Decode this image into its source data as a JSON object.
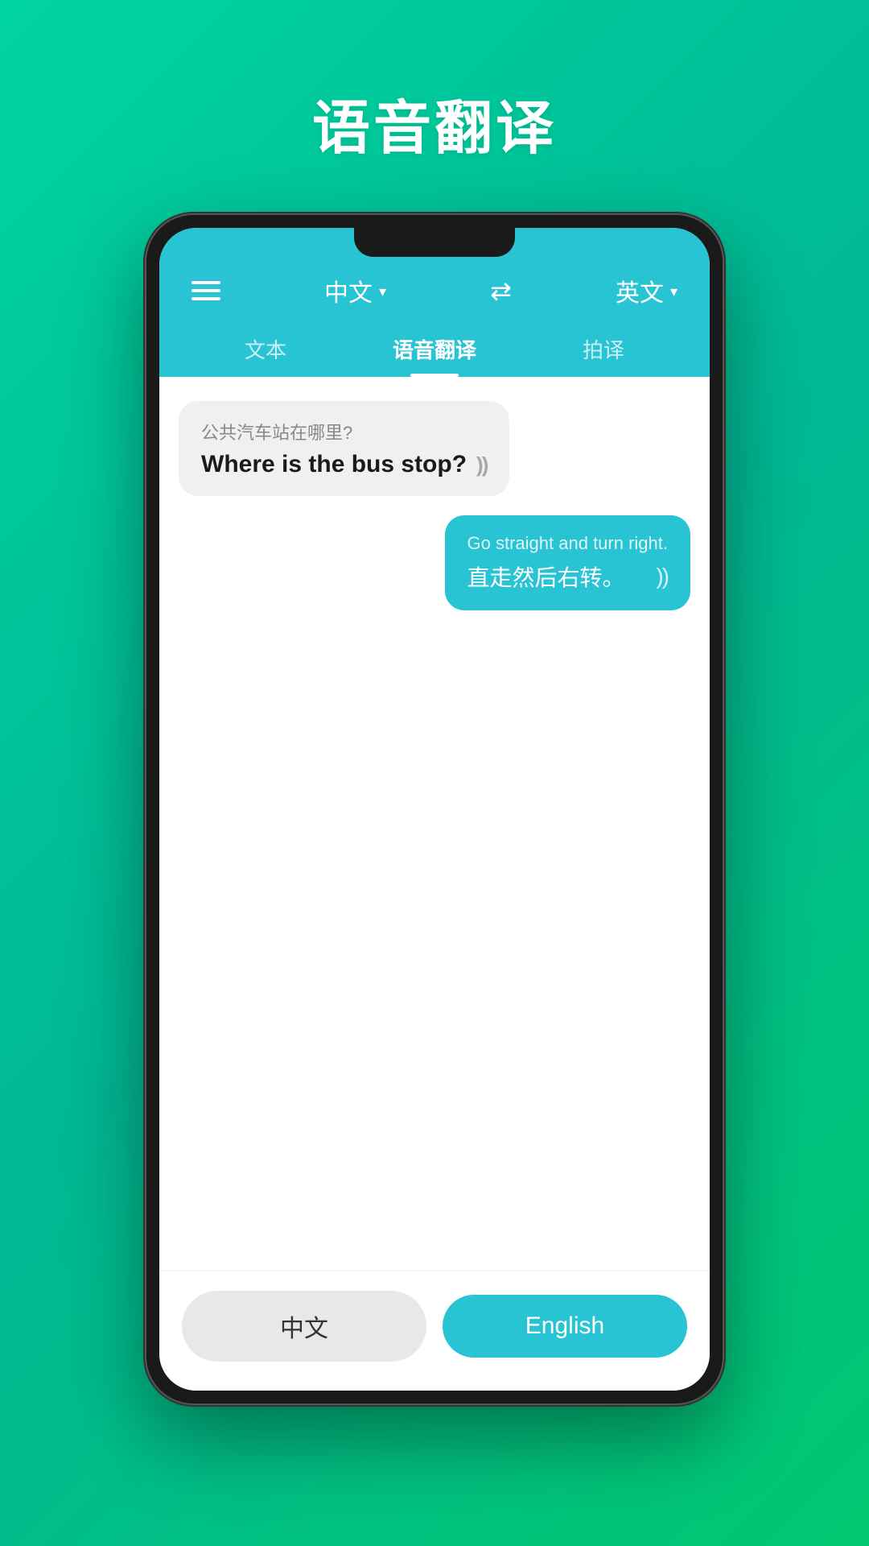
{
  "page": {
    "title": "语音翻译",
    "background_gradient_start": "#00d4a0",
    "background_gradient_end": "#00c870"
  },
  "header": {
    "source_lang": "中文",
    "source_lang_dropdown": "▾",
    "swap_label": "swap",
    "target_lang": "英文",
    "target_lang_dropdown": "▾"
  },
  "tabs": [
    {
      "id": "text",
      "label": "文本",
      "active": false
    },
    {
      "id": "voice",
      "label": "语音翻译",
      "active": true
    },
    {
      "id": "photo",
      "label": "拍译",
      "active": false
    }
  ],
  "messages": [
    {
      "side": "left",
      "original": "公共汽车站在哪里?",
      "translated": "Where is the bus stop?",
      "has_audio": true
    },
    {
      "side": "right",
      "original": "Go straight and turn right.",
      "translated": "直走然后右转。",
      "has_audio": true
    }
  ],
  "bottom_buttons": {
    "chinese_label": "中文",
    "english_label": "English"
  },
  "icons": {
    "hamburger": "≡",
    "swap": "⇄",
    "sound": "))",
    "chevron": "▾"
  }
}
